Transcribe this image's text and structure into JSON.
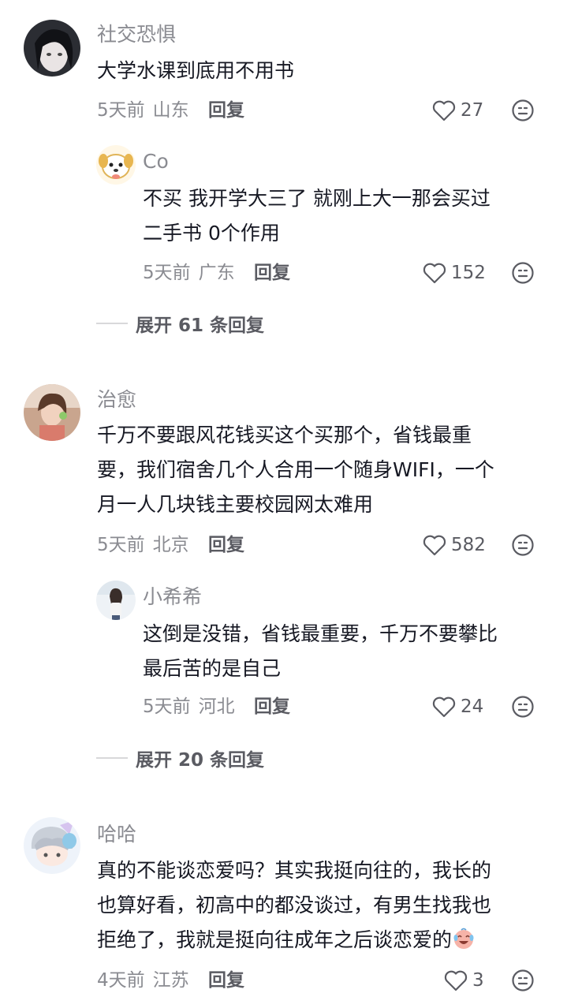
{
  "comments": [
    {
      "user": "社交恐惧",
      "text": "大学水课到底用不用书",
      "time": "5天前",
      "location": "山东",
      "reply_label": "回复",
      "likes": "27",
      "replies": [
        {
          "user": "Co",
          "text_lines": [
            "不买  我开学大三了  就刚上大一那会买过",
            "二手书  0个作用"
          ],
          "time": "5天前",
          "location": "广东",
          "reply_label": "回复",
          "likes": "152"
        }
      ],
      "expand_label": "展开 61 条回复"
    },
    {
      "user": "治愈",
      "text_lines": [
        "千万不要跟风花钱买这个买那个，省钱最重",
        "要，我们宿舍几个人合用一个随身WIFI，一个",
        "月一人几块钱主要校园网太难用"
      ],
      "time": "5天前",
      "location": "北京",
      "reply_label": "回复",
      "likes": "582",
      "replies": [
        {
          "user": "小希希",
          "text_lines": [
            "这倒是没错，省钱最重要，千万不要攀比",
            "最后苦的是自己"
          ],
          "time": "5天前",
          "location": "河北",
          "reply_label": "回复",
          "likes": "24"
        }
      ],
      "expand_label": "展开 20 条回复"
    },
    {
      "user": "哈哈",
      "text_lines": [
        "真的不能谈恋爱吗？其实我挺向往的，我长的",
        "也算好看，初高中的都没谈过，有男生找我也",
        "拒绝了，我就是挺向往成年之后谈恋爱的"
      ],
      "time": "4天前",
      "location": "江苏",
      "reply_label": "回复",
      "likes": "3"
    }
  ],
  "icons": {
    "like": "heart-outline-icon",
    "dislike": "neutral-face-icon",
    "inline_emoji": "crying-laughing-emoji-icon"
  },
  "colors": {
    "username": "#8a8b91",
    "text": "#161823",
    "meta": "#8a8b91",
    "action": "#5a5b62"
  }
}
